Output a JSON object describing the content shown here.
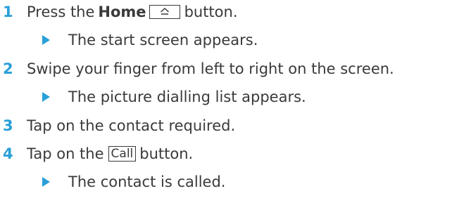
{
  "steps": [
    {
      "number": "1",
      "text_before": "Press the",
      "key_label": "Home",
      "text_after": "button."
    },
    {
      "result": "The start screen appears."
    },
    {
      "number": "2",
      "text": "Swipe your finger from left to right on the screen."
    },
    {
      "result": "The picture dialling list appears."
    },
    {
      "number": "3",
      "text": "Tap on the contact required."
    },
    {
      "number": "4",
      "text_before": "Tap on the",
      "button_label": "Call",
      "text_after": "button."
    },
    {
      "result": "The contact is called."
    }
  ],
  "colors": {
    "accent": "#2a9fd8",
    "text": "#3a3a3a"
  },
  "icons": {
    "home_key": "home-icon",
    "bullet": "triangle-bullet-icon"
  }
}
